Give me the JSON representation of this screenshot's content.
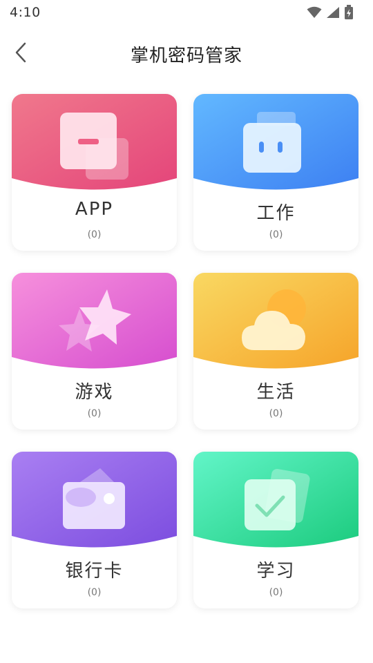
{
  "status_bar": {
    "time": "4:10",
    "icons": [
      "wifi-icon",
      "signal-icon",
      "battery-charging-icon"
    ]
  },
  "header": {
    "back_icon": "chevron-left-icon",
    "title": "掌机密码管家"
  },
  "categories": [
    {
      "label": "APP",
      "count": "(0)",
      "icon": "app-window-icon",
      "colors": [
        "#f0768a",
        "#e4497a"
      ]
    },
    {
      "label": "工作",
      "count": "(0)",
      "icon": "briefcase-icon",
      "colors": [
        "#5fb4ff",
        "#3f83f3"
      ]
    },
    {
      "label": "游戏",
      "count": "(0)",
      "icon": "star-icon",
      "colors": [
        "#f38ad9",
        "#d94fd1"
      ]
    },
    {
      "label": "生活",
      "count": "(0)",
      "icon": "cloud-sun-icon",
      "colors": [
        "#f8d560",
        "#f7a82b"
      ]
    },
    {
      "label": "银行卡",
      "count": "(0)",
      "icon": "wallet-card-icon",
      "colors": [
        "#a57bf0",
        "#7e4fe0"
      ]
    },
    {
      "label": "学习",
      "count": "(0)",
      "icon": "checklist-icon",
      "colors": [
        "#5ff3c4",
        "#1fcc80"
      ]
    }
  ]
}
